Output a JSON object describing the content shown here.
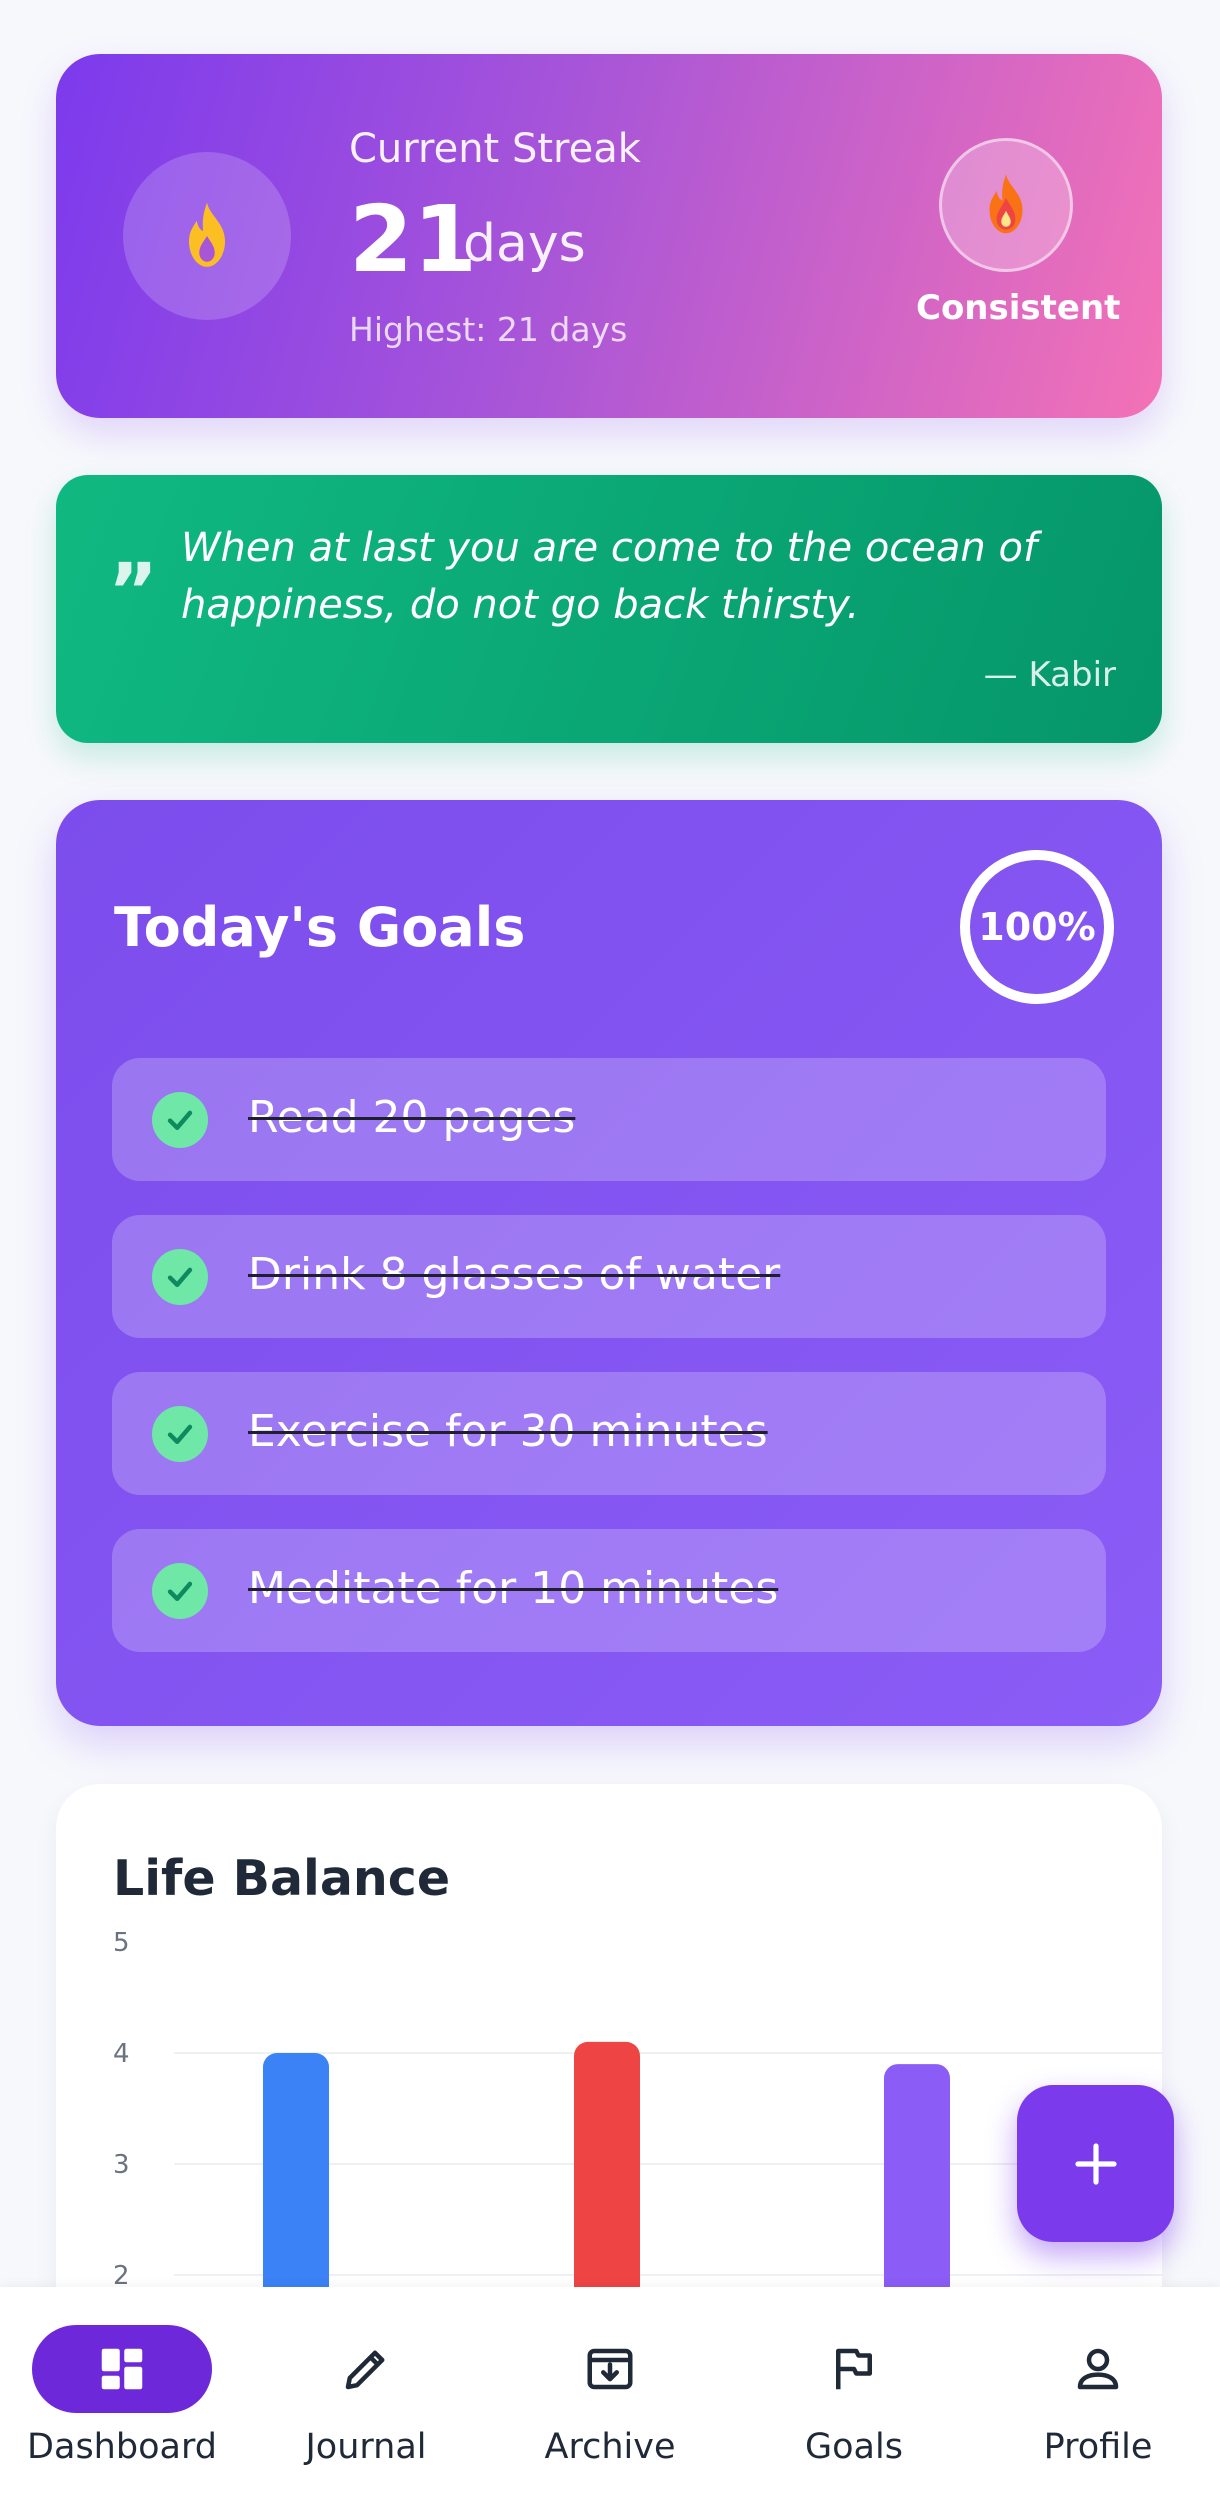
{
  "streak": {
    "label": "Current Streak",
    "count": "21",
    "unit": "days",
    "highest": "Highest: 21 days",
    "badge": "Consistent"
  },
  "quote": {
    "text": "When at last you are come to the ocean of happiness, do not go back thirsty.",
    "author": "— Kabir"
  },
  "goals": {
    "title": "Today's Goals",
    "progress": "100%",
    "items": [
      {
        "label": "Read 20 pages",
        "done": true
      },
      {
        "label": "Drink 8 glasses of water",
        "done": true
      },
      {
        "label": "Exercise for 30 minutes",
        "done": true
      },
      {
        "label": "Meditate for 10 minutes",
        "done": true
      }
    ]
  },
  "balance": {
    "title": "Life Balance"
  },
  "chart_data": {
    "type": "bar",
    "title": "Life Balance",
    "ylim": [
      0,
      5
    ],
    "yticks": [
      "5",
      "4",
      "3",
      "2"
    ],
    "grid": true,
    "series": [
      {
        "values": [
          4.0,
          4.1,
          3.9
        ],
        "colors": [
          "#3b82f6",
          "#ef4444",
          "#8b5cf6"
        ]
      }
    ]
  },
  "nav": {
    "items": [
      "Dashboard",
      "Journal",
      "Archive",
      "Goals",
      "Profile"
    ],
    "active": "Dashboard"
  },
  "colors": {
    "primary": "#7c3aed",
    "success": "#10b981",
    "check": "#6ee7a7"
  }
}
